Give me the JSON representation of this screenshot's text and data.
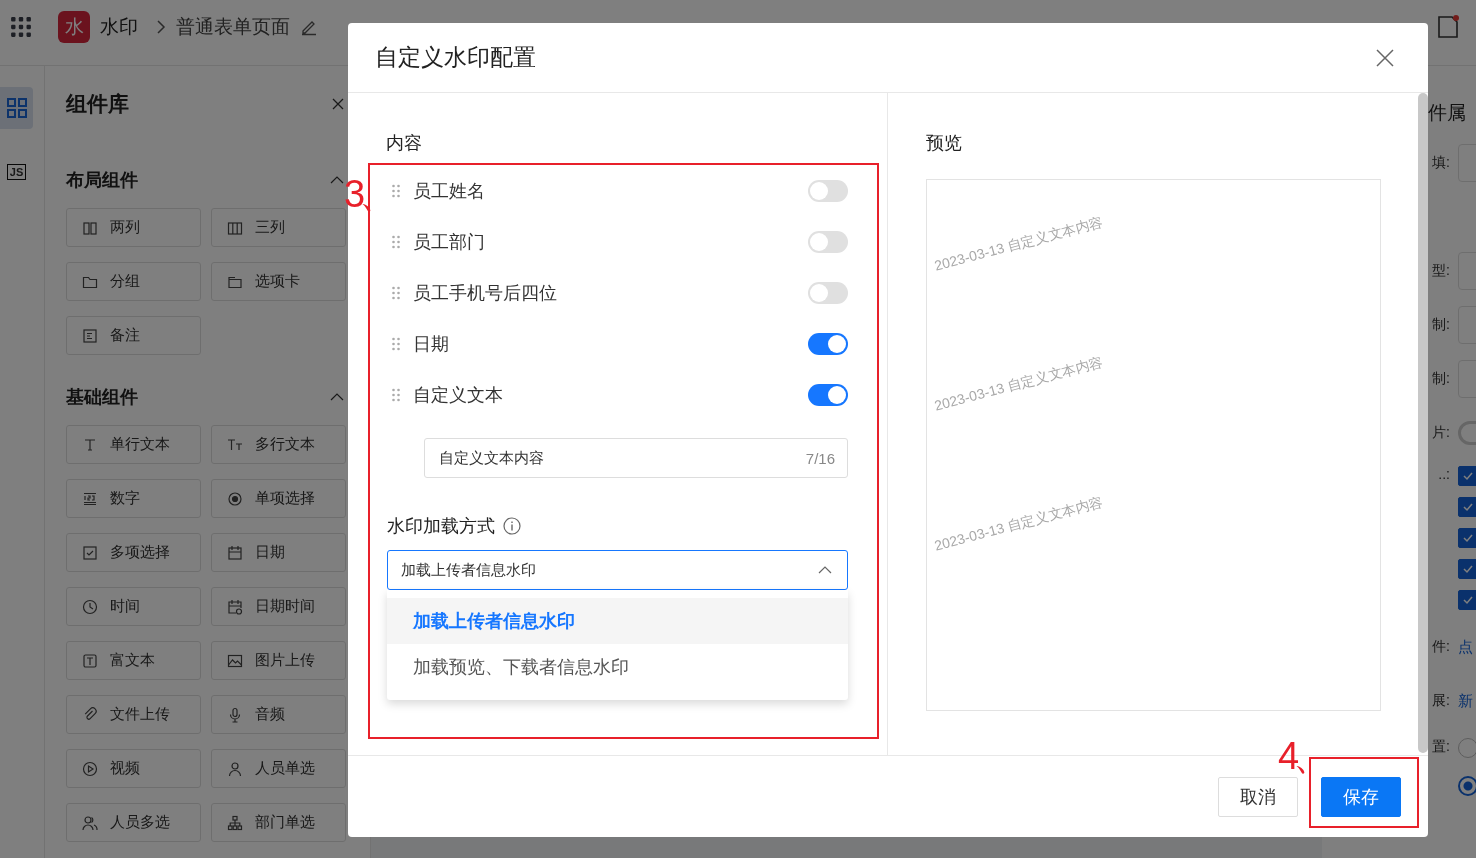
{
  "top_bar": {
    "logo": "水",
    "app_name": "水印",
    "page_name": "普通表单页面"
  },
  "icon_strip": [
    {
      "kind": "grid",
      "selected": true
    },
    {
      "kind": "js",
      "label": "JS",
      "selected": false
    }
  ],
  "component_panel": {
    "title": "组件库",
    "sections": [
      {
        "title": "布局组件",
        "expanded": true,
        "items": [
          "两列",
          "三列",
          "分组",
          "选项卡",
          "备注"
        ]
      },
      {
        "title": "基础组件",
        "expanded": true,
        "items": [
          "单行文本",
          "多行文本",
          "数字",
          "单项选择",
          "多项选择",
          "日期",
          "时间",
          "日期时间",
          "富文本",
          "图片上传",
          "文件上传",
          "音频",
          "视频",
          "人员单选",
          "人员多选",
          "部门单选"
        ]
      }
    ]
  },
  "property_panel": {
    "title": "件属",
    "rows": [
      {
        "label": "填:",
        "kind": "input"
      },
      {
        "label": "型:",
        "kind": "select"
      },
      {
        "label": "制:",
        "kind": "input"
      },
      {
        "label": "制:",
        "kind": "input"
      },
      {
        "label": "片:",
        "kind": "toggle",
        "on": false
      },
      {
        "label": "..:",
        "kind": "checkboxes",
        "checks": [
          {
            "checked": true
          },
          {
            "checked": true
          },
          {
            "checked": true
          },
          {
            "checked": true
          },
          {
            "checked": true
          }
        ]
      },
      {
        "label": "件:",
        "kind": "link",
        "value": "点"
      },
      {
        "label": "展:",
        "kind": "link",
        "value": "新"
      },
      {
        "label": "置:",
        "kind": "radios",
        "options": [
          {
            "selected": false
          },
          {
            "selected": true
          }
        ]
      }
    ]
  },
  "modal": {
    "title": "自定义水印配置",
    "content_label": "内容",
    "fields": [
      {
        "label": "员工姓名",
        "on": false
      },
      {
        "label": "员工部门",
        "on": false
      },
      {
        "label": "员工手机号后四位",
        "on": false
      },
      {
        "label": "日期",
        "on": true
      },
      {
        "label": "自定义文本",
        "on": true
      }
    ],
    "custom_text": {
      "value": "自定义文本内容",
      "count": "7/16"
    },
    "load_mode": {
      "label": "水印加载方式",
      "value": "加载上传者信息水印",
      "expanded": true,
      "options": [
        {
          "label": "加载上传者信息水印",
          "selected": true
        },
        {
          "label": "加载预览、下载者信息水印",
          "selected": false
        }
      ]
    },
    "preview": {
      "label": "预览",
      "watermarks": [
        "2023-03-13 自定义文本内容",
        "2023-03-13 自定义文本内容",
        "2023-03-13 自定义文本内容"
      ]
    },
    "buttons": [
      {
        "label": "取消",
        "kind": "secondary"
      },
      {
        "label": "保存",
        "kind": "primary"
      }
    ]
  },
  "annotations": [
    {
      "label": "3、"
    },
    {
      "label": "4、"
    }
  ]
}
